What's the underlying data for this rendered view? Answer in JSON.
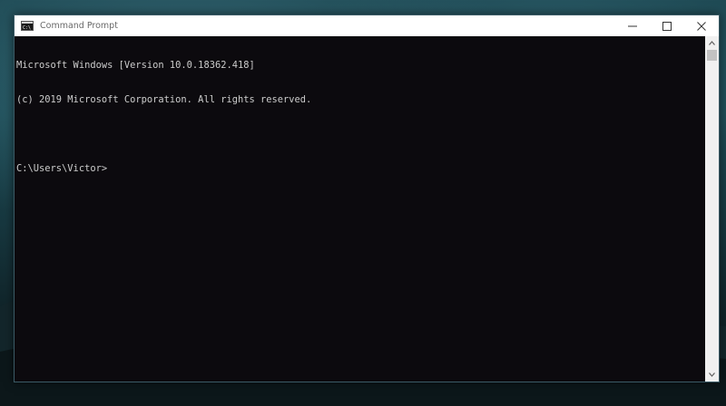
{
  "window": {
    "title": "Command Prompt",
    "icon": "command-prompt-icon"
  },
  "controls": {
    "minimize": "minimize-icon",
    "maximize": "maximize-icon",
    "close": "close-icon"
  },
  "console": {
    "lines": [
      "Microsoft Windows [Version 10.0.18362.418]",
      "(c) 2019 Microsoft Corporation. All rights reserved.",
      "",
      "C:\\Users\\Victor>"
    ]
  },
  "colors": {
    "console_background": "#0c0a0e",
    "console_text": "#cccccc",
    "titlebar_background": "#ffffff",
    "desktop_teal": "#1d4b55"
  }
}
